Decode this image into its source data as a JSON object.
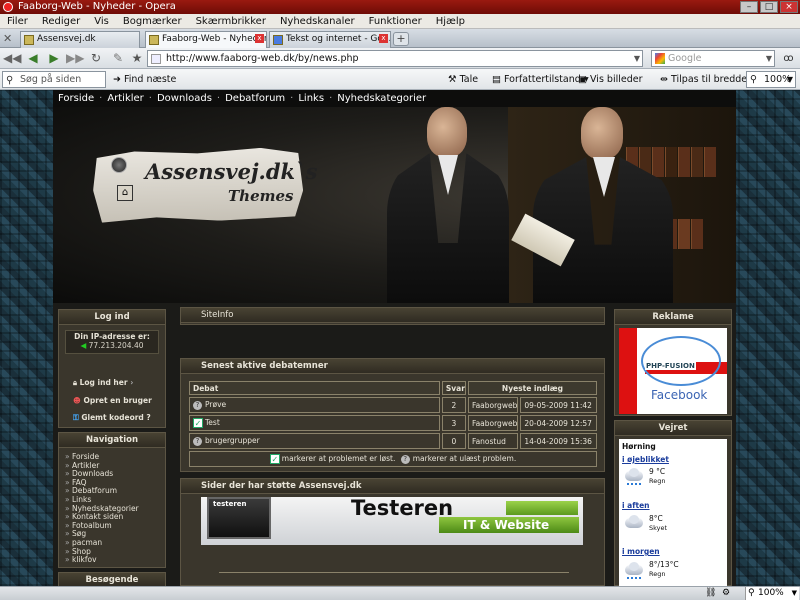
{
  "window": {
    "title": "Faaborg-Web - Nyheder - Opera"
  },
  "menu": [
    "Filer",
    "Rediger",
    "Vis",
    "Bogmærker",
    "Skærmbrikker",
    "Nyhedskanaler",
    "Funktioner",
    "Hjælp"
  ],
  "tabs": [
    {
      "label": "Assensvej.dk"
    },
    {
      "label": "Faaborg-Web - Nyheder"
    },
    {
      "label": "Tekst og internet - Go..."
    }
  ],
  "address": {
    "url": "http://www.faaborg-web.dk/by/news.php"
  },
  "search": {
    "placeholder": "Google"
  },
  "toolbar": {
    "find_placeholder": "Søg på siden",
    "find_next": "Find næste",
    "speak": "Tale",
    "author_mode": "Forfattertilstand",
    "show_images": "Vis billeder",
    "fit_width": "Tilpas til bredden",
    "zoom": "100%"
  },
  "site": {
    "nav": [
      "Forside",
      "Artikler",
      "Downloads",
      "Debatforum",
      "Links",
      "Nyhedskategorier"
    ],
    "logo_line1": "Assensvej.dk`s",
    "logo_line2": "Themes"
  },
  "login": {
    "title": "Log ind",
    "ip_label": "Din IP-adresse er:",
    "ip": "77.213.204.40",
    "login_here": "Log ind her",
    "create_user": "Opret en bruger",
    "forgot": "Glemt kodeord ?"
  },
  "navigation": {
    "title": "Navigation",
    "items": [
      "Forside",
      "Artikler",
      "Downloads",
      "FAQ",
      "Debatforum",
      "Links",
      "Nyhedskategorier",
      "Kontakt siden",
      "Fotoalbum",
      "Søg",
      "pacman",
      "Shop",
      "klikfov"
    ]
  },
  "visitors": {
    "title": "Besøgende"
  },
  "siteinfo": {
    "title": "SiteInfo"
  },
  "forum": {
    "title": "Senest aktive debatemner",
    "headers": [
      "Debat",
      "Svar",
      "Nyeste indlæg"
    ],
    "rows": [
      {
        "topic": "Prøve",
        "replies": "2",
        "author": "Faaborgweb",
        "date": "09-05-2009 11:42"
      },
      {
        "topic": "Test",
        "replies": "3",
        "author": "Faaborgweb",
        "date": "20-04-2009 12:57"
      },
      {
        "topic": "brugergrupper",
        "replies": "0",
        "author": "Fanostud",
        "date": "14-04-2009 15:36"
      }
    ],
    "legend_solved": "markerer at problemet er løst.",
    "legend_unread": "markerer at ulæst problem."
  },
  "sponsors": {
    "title": "Sider der har støtte Assensvej.dk",
    "banner_main": "Testeren",
    "banner_sub": "IT & Website",
    "banner_small": "testeren"
  },
  "ads": {
    "title": "Reklame",
    "php_fusion": "PHP-FUSION",
    "facebook": "Facebook"
  },
  "weather": {
    "title": "Vejret",
    "location": "Hørning",
    "periods": [
      {
        "label": "i øjeblikket",
        "temp": "9 °C",
        "desc": "Regn"
      },
      {
        "label": "i aften",
        "temp": "8°C",
        "desc": "Skyet"
      },
      {
        "label": "i morgen",
        "temp": "8°/13°C",
        "desc": "Regn"
      }
    ]
  },
  "status": {
    "zoom": "100%"
  }
}
